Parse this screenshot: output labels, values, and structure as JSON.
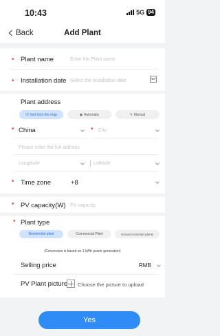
{
  "status_bar": {
    "time": "10:43",
    "network": "5G",
    "battery": "94"
  },
  "nav": {
    "back_label": "Back",
    "title": "Add Plant"
  },
  "form": {
    "plant_name": {
      "label": "Plant name",
      "placeholder": "Enter the Plant name"
    },
    "installation_date": {
      "label": "Installation date",
      "placeholder": "Select the installation date"
    },
    "plant_address": {
      "label": "Plant address",
      "buttons": [
        "Get from the map",
        "Automatic",
        "Manual"
      ],
      "country": "China",
      "city_placeholder": "City",
      "full_address_placeholder": "Please enter the full address",
      "longitude_placeholder": "Longitude",
      "latitude_placeholder": "Latitude"
    },
    "time_zone": {
      "label": "Time zone",
      "value": "+8"
    },
    "pv_capacity": {
      "label": "PV capacity(W)",
      "placeholder": "PV capacity"
    },
    "plant_type": {
      "label": "Plant type",
      "options": [
        "Residential plant",
        "Commercial Plant",
        "Ground-mounted plants"
      ],
      "selected": "Residential plant",
      "note": "(Conversion is based on 1 kWh power generation)"
    },
    "selling_price": {
      "label": "Selling price",
      "currency": "RMB"
    },
    "pv_plant_picture": {
      "label": "PV Plant picture",
      "hint": "Choose the picture to upload"
    }
  },
  "submit_label": "Yes",
  "colors": {
    "accent": "#2f8cf6",
    "required": "#e24b3c"
  }
}
